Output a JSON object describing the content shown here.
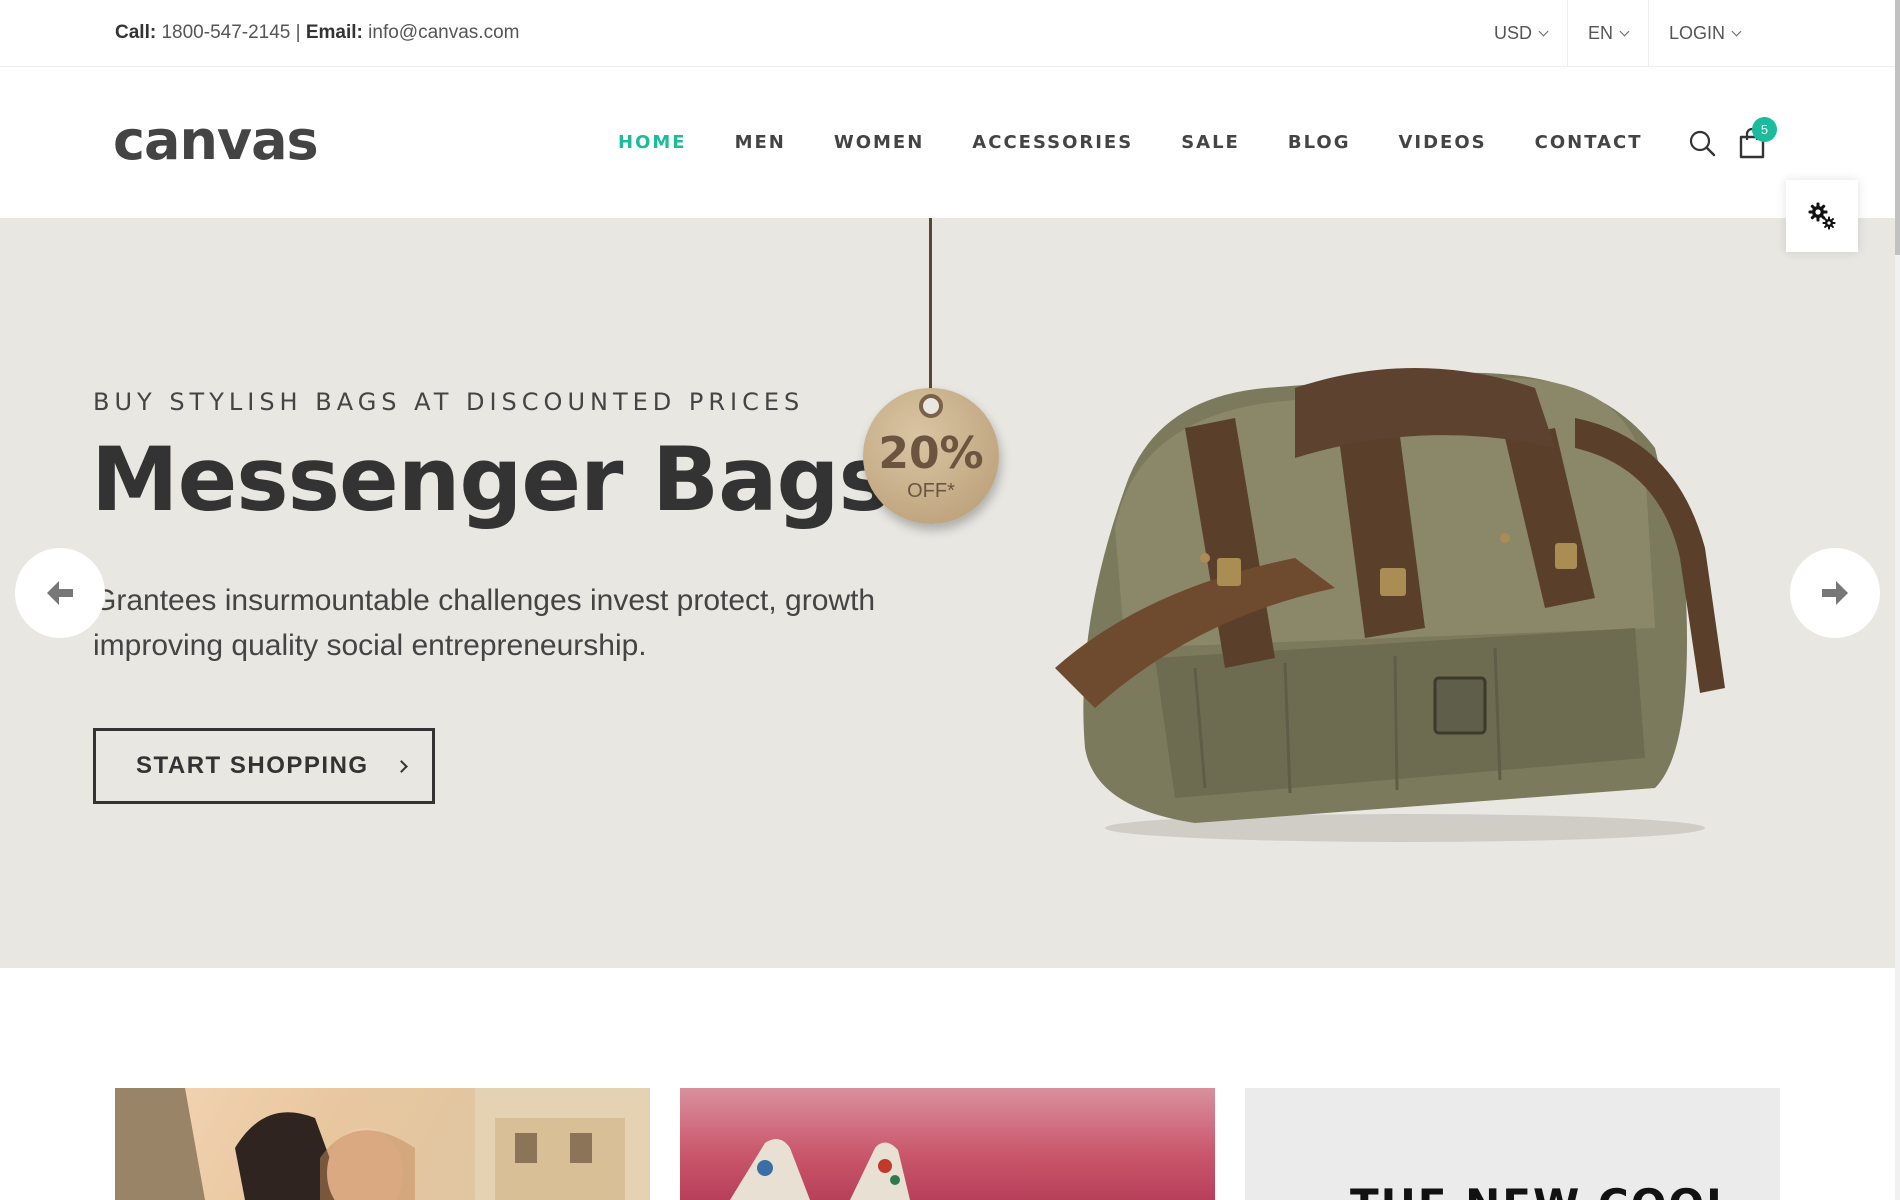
{
  "topbar": {
    "call_label": "Call:",
    "phone": "1800-547-2145",
    "separator": "|",
    "email_label": "Email:",
    "email": "info@canvas.com",
    "currency": "USD",
    "language": "EN",
    "login": "LOGIN"
  },
  "header": {
    "logo": "canvas",
    "nav": [
      {
        "label": "HOME",
        "active": true
      },
      {
        "label": "MEN"
      },
      {
        "label": "WOMEN"
      },
      {
        "label": "ACCESSORIES"
      },
      {
        "label": "SALE"
      },
      {
        "label": "BLOG"
      },
      {
        "label": "VIDEOS"
      },
      {
        "label": "CONTACT"
      }
    ],
    "cart_count": "5",
    "icons": [
      "search-icon",
      "cart-icon",
      "gear-icon"
    ]
  },
  "hero": {
    "subtitle": "BUY STYLISH BAGS AT DISCOUNTED PRICES",
    "title": "Messenger Bags",
    "tag_percent": "20%",
    "tag_off": "OFF*",
    "description": "Grantees insurmountable challenges invest protect, growth improving quality social entrepreneurship.",
    "cta": "START SHOPPING",
    "background": "#e8e7e2"
  },
  "cards": {
    "card3_text": "THE NEW COOL"
  },
  "colors": {
    "accent": "#1abc9c",
    "text": "#333333"
  }
}
